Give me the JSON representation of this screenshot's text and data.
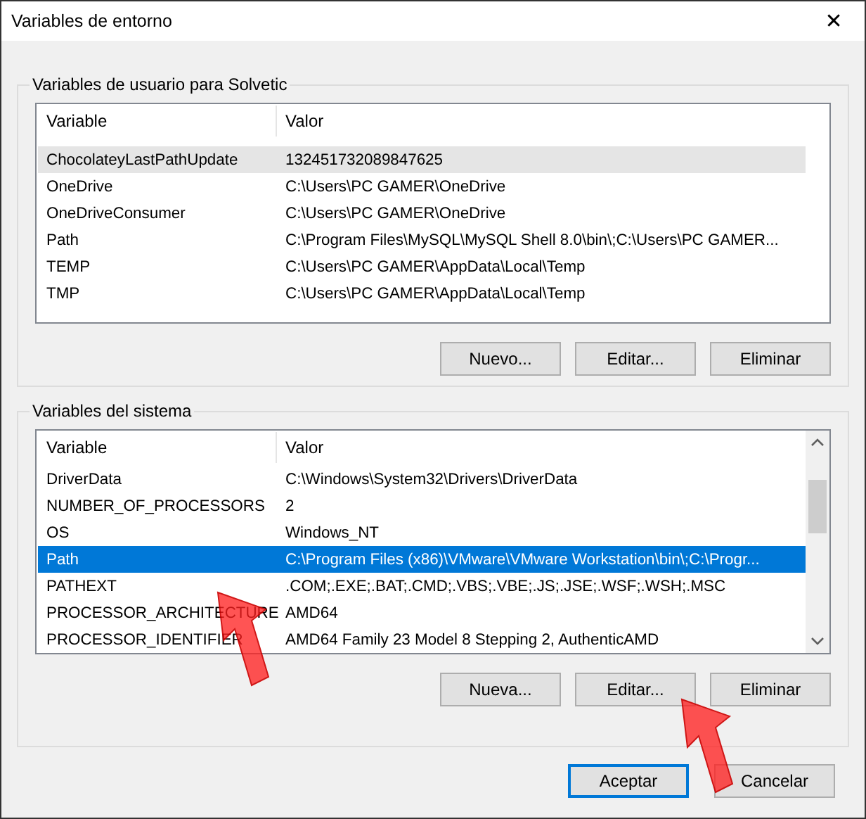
{
  "window": {
    "title": "Variables de entorno",
    "close": "✕"
  },
  "user_variables": {
    "title": "Variables de usuario para Solvetic",
    "columns": [
      "Variable",
      "Valor"
    ],
    "rows": [
      {
        "variable": "ChocolateyLastPathUpdate",
        "value": "132451732089847625",
        "selected": false,
        "hovered": true
      },
      {
        "variable": "OneDrive",
        "value": "C:\\Users\\PC GAMER\\OneDrive",
        "selected": false,
        "hovered": false
      },
      {
        "variable": "OneDriveConsumer",
        "value": "C:\\Users\\PC GAMER\\OneDrive",
        "selected": false,
        "hovered": false
      },
      {
        "variable": "Path",
        "value": "C:\\Program Files\\MySQL\\MySQL Shell 8.0\\bin\\;C:\\Users\\PC GAMER...",
        "selected": false,
        "hovered": false
      },
      {
        "variable": "TEMP",
        "value": "C:\\Users\\PC GAMER\\AppData\\Local\\Temp",
        "selected": false,
        "hovered": false
      },
      {
        "variable": "TMP",
        "value": "C:\\Users\\PC GAMER\\AppData\\Local\\Temp",
        "selected": false,
        "hovered": false
      }
    ],
    "buttons": [
      "Nuevo...",
      "Editar...",
      "Eliminar"
    ]
  },
  "system_variables": {
    "title": "Variables del sistema",
    "columns": [
      "Variable",
      "Valor"
    ],
    "rows": [
      {
        "variable": "DriverData",
        "value": "C:\\Windows\\System32\\Drivers\\DriverData",
        "selected": false,
        "hovered": false
      },
      {
        "variable": "NUMBER_OF_PROCESSORS",
        "value": "2",
        "selected": false,
        "hovered": false
      },
      {
        "variable": "OS",
        "value": "Windows_NT",
        "selected": false,
        "hovered": false
      },
      {
        "variable": "Path",
        "value": "C:\\Program Files (x86)\\VMware\\VMware Workstation\\bin\\;C:\\Progr...",
        "selected": true,
        "hovered": false
      },
      {
        "variable": "PATHEXT",
        "value": ".COM;.EXE;.BAT;.CMD;.VBS;.VBE;.JS;.JSE;.WSF;.WSH;.MSC",
        "selected": false,
        "hovered": false
      },
      {
        "variable": "PROCESSOR_ARCHITECTURE",
        "value": "AMD64",
        "selected": false,
        "hovered": false
      },
      {
        "variable": "PROCESSOR_IDENTIFIER",
        "value": "AMD64 Family 23 Model 8 Stepping 2, AuthenticAMD",
        "selected": false,
        "hovered": false
      }
    ],
    "buttons": [
      "Nueva...",
      "Editar...",
      "Eliminar"
    ]
  },
  "dialog_buttons": [
    {
      "label": "Aceptar",
      "default": true
    },
    {
      "label": "Cancelar",
      "default": false
    }
  ]
}
